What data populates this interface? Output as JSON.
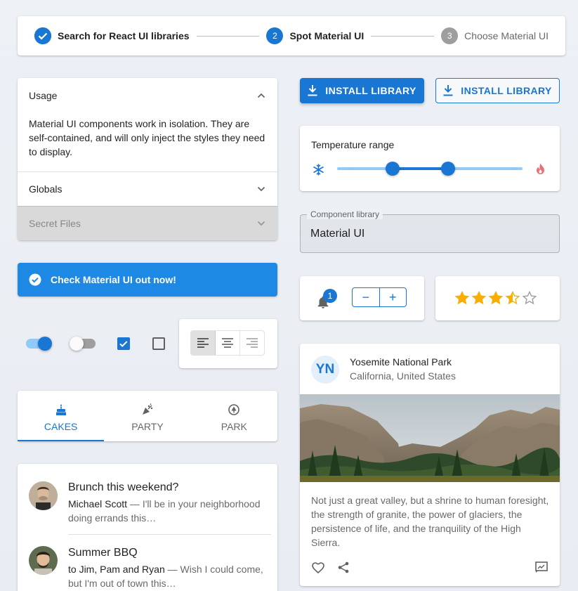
{
  "stepper": {
    "steps": [
      {
        "number": "1",
        "label": "Search for React UI libraries",
        "state": "completed"
      },
      {
        "number": "2",
        "label": "Spot Material UI",
        "state": "active"
      },
      {
        "number": "3",
        "label": "Choose Material UI",
        "state": "pending"
      }
    ]
  },
  "accordion": {
    "panels": [
      {
        "title": "Usage",
        "expanded": true,
        "body": "Material UI components work in isolation. They are self-contained, and will only inject the styles they need to display."
      },
      {
        "title": "Globals",
        "expanded": false
      },
      {
        "title": "Secret Files",
        "expanded": false,
        "disabled": true
      }
    ]
  },
  "alert": {
    "message": "Check Material UI out now!",
    "color": "#1e88e5"
  },
  "controls": {
    "switch_on": true,
    "switch_off": false,
    "checkbox_checked": true,
    "checkbox_unchecked": false,
    "alignment_selected": "left"
  },
  "tabs": {
    "items": [
      {
        "label": "CAKES",
        "icon": "cake-icon",
        "active": true
      },
      {
        "label": "PARTY",
        "icon": "celebration-icon",
        "active": false
      },
      {
        "label": "PARK",
        "icon": "park-icon",
        "active": false
      }
    ]
  },
  "emails": [
    {
      "title": "Brunch this weekend?",
      "from": "Michael Scott",
      "preview": " — I'll be in your neighborhood doing errands this…"
    },
    {
      "title": "Summer BBQ",
      "from": "to Jim, Pam and Ryan",
      "preview": " — Wish I could come, but I'm out of town this…"
    }
  ],
  "buttons": {
    "install_contained": "INSTALL LIBRARY",
    "install_outlined": "INSTALL LIBRARY"
  },
  "slider": {
    "label": "Temperature range",
    "low": 0.3,
    "high": 0.6,
    "left_icon": "ac-unit-icon",
    "right_icon": "fire-icon"
  },
  "select": {
    "label": "Component library",
    "value": "Material UI"
  },
  "badge": {
    "count": "1",
    "icon": "notifications-icon"
  },
  "stepper_buttons": {
    "minus": "−",
    "plus": "+"
  },
  "rating": {
    "value": 3.5,
    "max": 5
  },
  "media_card": {
    "avatar": "YN",
    "title": "Yosemite National Park",
    "subheader": "California, United States",
    "description": "Not just a great valley, but a shrine to human foresight, the strength of granite, the power of glaciers, the persistence of life, and the tranquility of the High Sierra."
  },
  "colors": {
    "primary": "#1976d2",
    "star": "#faaf00"
  }
}
